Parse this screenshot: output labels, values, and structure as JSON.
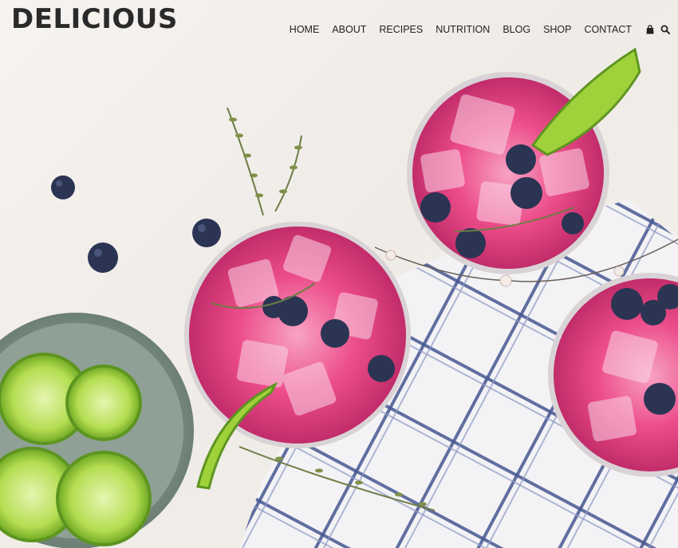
{
  "site": {
    "logo": "DELICIOUS"
  },
  "nav": {
    "items": [
      {
        "label": "HOME"
      },
      {
        "label": "ABOUT"
      },
      {
        "label": "RECIPES"
      },
      {
        "label": "NUTRITION"
      },
      {
        "label": "BLOG"
      },
      {
        "label": "SHOP"
      },
      {
        "label": "CONTACT"
      }
    ],
    "icons": [
      "shopping-bag-icon",
      "search-icon"
    ]
  },
  "colors": {
    "text": "#222222",
    "drink": "#e8467f",
    "lime": "#9fd13a",
    "blueberry": "#2b3453",
    "cloth_stripe": "#3d4f8c"
  }
}
